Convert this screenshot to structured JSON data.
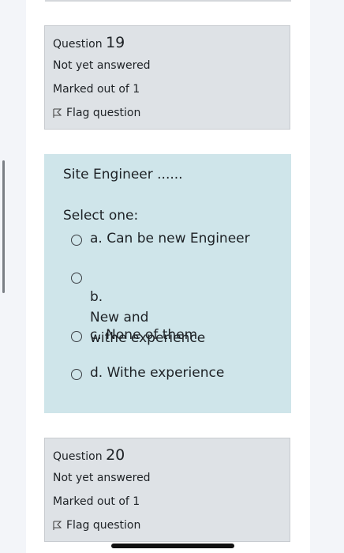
{
  "question19": {
    "label": "Question",
    "number": "19",
    "status": "Not yet answered",
    "marks": "Marked out of 1",
    "flag_label": "Flag question"
  },
  "current_question": {
    "text": "Site Engineer ......",
    "prompt": "Select one:",
    "options": [
      {
        "letter": "a.",
        "text": "Can be new Engineer"
      },
      {
        "letter": "b.",
        "text": "New and\nwithe experience"
      },
      {
        "letter": "c.",
        "text": "None of them"
      },
      {
        "letter": "d.",
        "text": "Withe experience"
      }
    ]
  },
  "question20": {
    "label": "Question",
    "number": "20",
    "status": "Not yet answered",
    "marks": "Marked out of 1",
    "flag_label": "Flag question"
  },
  "colors": {
    "question_bg": "#cfe5ea",
    "info_bg": "#dee2e6"
  }
}
